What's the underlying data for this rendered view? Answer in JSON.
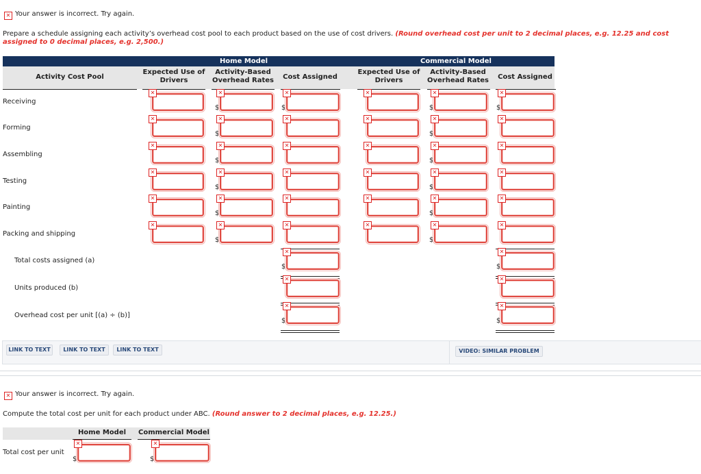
{
  "part1": {
    "status_text": "Your answer is incorrect.  Try again.",
    "status_icon": "incorrect-x-icon",
    "instruction": "Prepare a schedule assigning each activity’s overhead cost pool to each product based on the use of cost drivers.",
    "instruction_note": "(Round overhead cost per unit to 2 decimal places, e.g. 12.25 and cost assigned to 0 decimal places, e.g. 2,500.)",
    "table": {
      "row_header": "Activity Cost Pool",
      "groups": [
        {
          "title": "Home Model",
          "columns": [
            "Expected Use of Drivers",
            "Activity-Based Overhead Rates",
            "Cost Assigned"
          ]
        },
        {
          "title": "Commercial Model",
          "columns": [
            "Expected Use of Drivers",
            "Activity-Based Overhead Rates",
            "Cost Assigned"
          ]
        }
      ],
      "rows": [
        {
          "label": "Receiving",
          "home": [
            "",
            "",
            ""
          ],
          "commercial": [
            "",
            "",
            ""
          ]
        },
        {
          "label": "Forming",
          "home": [
            "",
            "",
            ""
          ],
          "commercial": [
            "",
            "",
            ""
          ]
        },
        {
          "label": "Assembling",
          "home": [
            "",
            "",
            ""
          ],
          "commercial": [
            "",
            "",
            ""
          ]
        },
        {
          "label": "Testing",
          "home": [
            "",
            "",
            ""
          ],
          "commercial": [
            "",
            "",
            ""
          ]
        },
        {
          "label": "Painting",
          "home": [
            "",
            "",
            ""
          ],
          "commercial": [
            "",
            "",
            ""
          ]
        },
        {
          "label": "Packing and shipping",
          "home": [
            "",
            "",
            ""
          ],
          "commercial": [
            "",
            "",
            ""
          ]
        }
      ],
      "summary_rows": [
        {
          "label": "Total costs assigned (a)",
          "home": "",
          "commercial": ""
        },
        {
          "label": "Units produced (b)",
          "home": "",
          "commercial": ""
        },
        {
          "label": "Overhead cost per unit [(a) ÷ (b)]",
          "home": "",
          "commercial": ""
        }
      ],
      "currency_symbol": "$"
    },
    "links": [
      "LINK TO TEXT",
      "LINK TO TEXT",
      "LINK TO TEXT"
    ],
    "video_link": "VIDEO: SIMILAR PROBLEM"
  },
  "part2": {
    "status_text": "Your answer is incorrect.  Try again.",
    "instruction": "Compute the total cost per unit for each product under ABC.",
    "instruction_note": "(Round answer to 2 decimal places, e.g. 12.25.)",
    "columns": [
      "Home Model",
      "Commercial Model"
    ],
    "row_label": "Total cost per unit",
    "values": [
      "",
      ""
    ],
    "currency_symbol": "$"
  },
  "colors": {
    "header_band": "#16325c",
    "error_red": "#e4312b",
    "link_text": "#2a4a7a"
  }
}
